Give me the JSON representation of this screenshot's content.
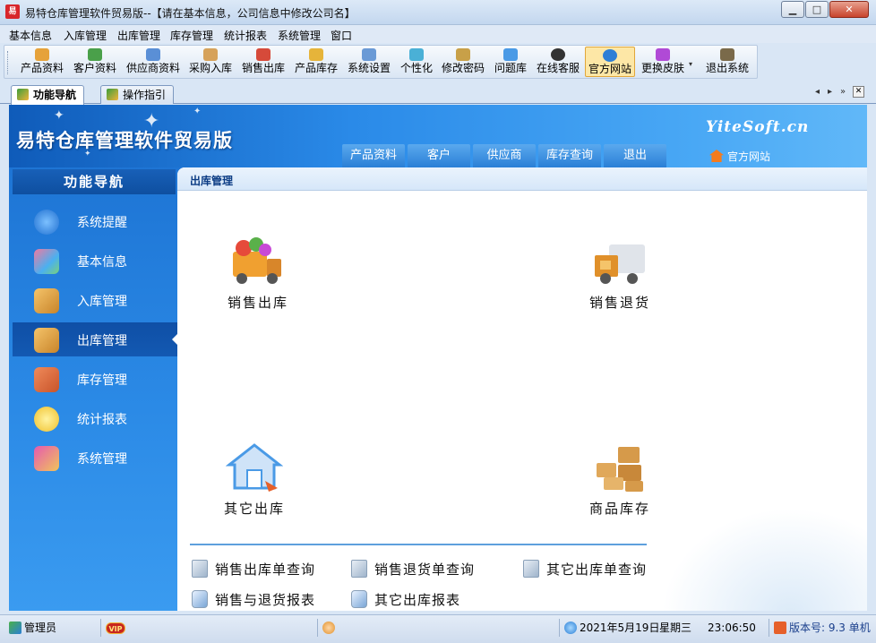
{
  "window": {
    "title": "易特仓库管理软件贸易版--【请在基本信息，公司信息中修改公司名】",
    "app_icon_text": "易",
    "min_glyph": "▁",
    "max_glyph": "□",
    "close_glyph": "✕"
  },
  "menu": [
    "基本信息",
    "入库管理",
    "出库管理",
    "库存管理",
    "统计报表",
    "系统管理",
    "窗口"
  ],
  "toolbar": [
    {
      "label": "产品资料",
      "icon": "product-icon",
      "color": "#e6a23a"
    },
    {
      "label": "客户资料",
      "icon": "customer-icon",
      "color": "#4aa04a"
    },
    {
      "label": "供应商资料",
      "icon": "supplier-icon",
      "color": "#5a8fd6"
    },
    {
      "label": "采购入库",
      "icon": "purchase-icon",
      "color": "#d6a25a"
    },
    {
      "label": "销售出库",
      "icon": "sales-icon",
      "color": "#d64a3a"
    },
    {
      "label": "产品库存",
      "icon": "stock-icon",
      "color": "#e6b43a"
    },
    {
      "label": "系统设置",
      "icon": "settings-icon",
      "color": "#6a9ad6"
    },
    {
      "label": "个性化",
      "icon": "personalize-icon",
      "color": "#4ab0d6"
    },
    {
      "label": "修改密码",
      "icon": "password-icon",
      "color": "#c8a048"
    },
    {
      "label": "问题库",
      "icon": "faq-icon",
      "color": "#4a9ae6"
    },
    {
      "label": "在线客服",
      "icon": "service-icon",
      "color": "#333333"
    },
    {
      "label": "官方网站",
      "icon": "website-icon",
      "color": "#2f7fd6"
    },
    {
      "label": "更换皮肤",
      "icon": "skin-icon",
      "color": "#b04ad6"
    },
    {
      "label": "退出系统",
      "icon": "exit-icon",
      "color": "#7a6a4a"
    }
  ],
  "toolbar_arrow": "▾",
  "tabs": [
    {
      "label": "功能导航",
      "active": true
    },
    {
      "label": "操作指引",
      "active": false
    }
  ],
  "tab_nav": {
    "prev": "◂",
    "next": "▸",
    "more": "»",
    "close": "✕"
  },
  "banner": {
    "title": "易特仓库管理软件贸易版",
    "site_name": "YiteSoft.cn",
    "site_link": "官方网站",
    "nav": [
      "产品资料",
      "客户",
      "供应商",
      "库存查询",
      "退出"
    ]
  },
  "sidebar": {
    "heading": "功能导航",
    "items": [
      {
        "label": "系统提醒",
        "icon": "info-icon",
        "color": "#2a8ae6",
        "active": false
      },
      {
        "label": "基本信息",
        "icon": "blocks-icon",
        "color": "#e64a6a",
        "active": false
      },
      {
        "label": "入库管理",
        "icon": "box-in-icon",
        "color": "#e6a23a",
        "active": false
      },
      {
        "label": "出库管理",
        "icon": "box-out-icon",
        "color": "#e6a23a",
        "active": true
      },
      {
        "label": "库存管理",
        "icon": "warehouse-icon",
        "color": "#e66a3a",
        "active": false
      },
      {
        "label": "统计报表",
        "icon": "chart-icon",
        "color": "#f0d24a",
        "active": false
      },
      {
        "label": "系统管理",
        "icon": "tools-icon",
        "color": "#d64ab0",
        "active": false
      }
    ]
  },
  "content": {
    "breadcrumb": "出库管理",
    "tiles": [
      {
        "label": "销售出库",
        "icon": "sales-truck-icon",
        "color": "#f0a030"
      },
      {
        "label": "销售退货",
        "icon": "return-truck-icon",
        "color": "#e0902a"
      },
      {
        "label": "其它出库",
        "icon": "other-out-icon",
        "color": "#4a9ae6"
      },
      {
        "label": "商品库存",
        "icon": "boxes-icon",
        "color": "#d69a4a"
      }
    ],
    "links": [
      {
        "label": "销售出库单查询",
        "icon": "doc-icon"
      },
      {
        "label": "销售退货单查询",
        "icon": "doc-icon"
      },
      {
        "label": "其它出库单查询",
        "icon": "doc-icon"
      },
      {
        "label": "销售与退货报表",
        "icon": "report-icon"
      },
      {
        "label": "其它出库报表",
        "icon": "report-icon"
      }
    ]
  },
  "status": {
    "user": "管理员",
    "vip": "VIP",
    "date": "2021年5月19日",
    "weekday": "星期三",
    "time": "23:06:50",
    "version": "版本号: 9.3 单机"
  }
}
